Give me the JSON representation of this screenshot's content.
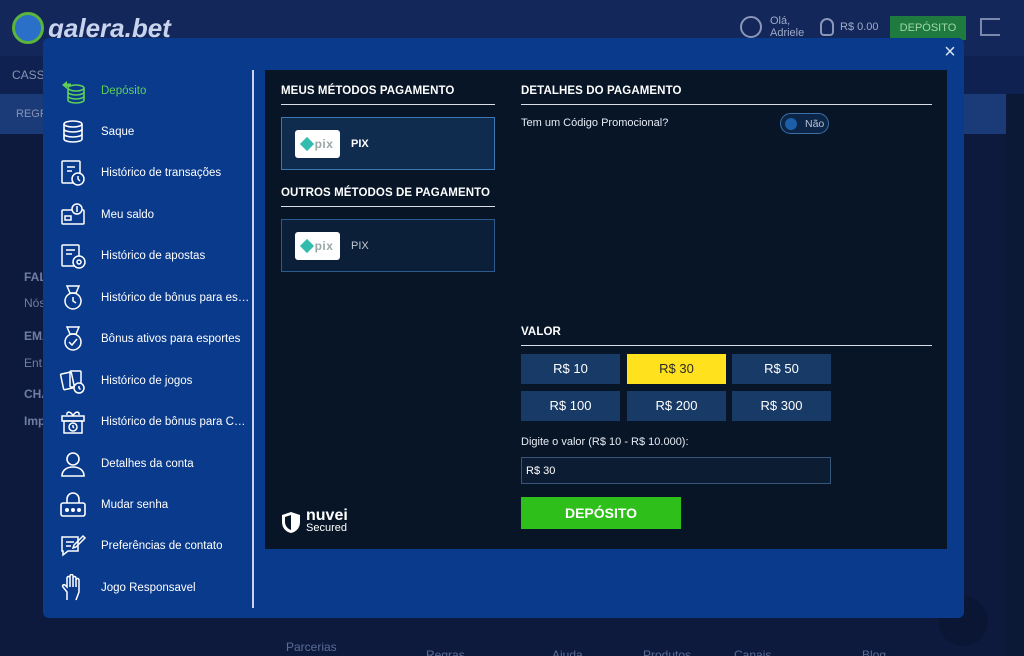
{
  "background": {
    "logo_text": "galera.bet",
    "user_greeting_line1": "Olá,",
    "user_greeting_line2": "Adriele",
    "balance": "R$ 0.00",
    "deposit_label": "DEPÓSITO",
    "nav_fragment": "CASS",
    "subnav_fragment": "REGR",
    "fragments": [
      "FAL",
      "Nós",
      "EMA",
      "Ent",
      "CHA",
      "Imp"
    ],
    "footer_fragments": [
      "Parcerias",
      "Regras",
      "Ajuda",
      "Produtos",
      "Canais",
      "Blog"
    ]
  },
  "modal": {
    "close_icon": "×",
    "menu": [
      {
        "label": "Depósito",
        "icon": "coins-stack-icon",
        "active": true
      },
      {
        "label": "Saque",
        "icon": "withdraw-icon",
        "active": false
      },
      {
        "label": "Histórico de transações",
        "icon": "transaction-history-icon",
        "active": false
      },
      {
        "label": "Meu saldo",
        "icon": "wallet-icon",
        "active": false
      },
      {
        "label": "Histórico de apostas",
        "icon": "bet-history-icon",
        "active": false
      },
      {
        "label": "Histórico de bônus para esportes",
        "icon": "sports-bonus-history-icon",
        "active": false
      },
      {
        "label": "Bônus ativos para esportes",
        "icon": "medal-check-icon",
        "active": false
      },
      {
        "label": "Histórico de jogos",
        "icon": "cards-history-icon",
        "active": false
      },
      {
        "label": "Histórico de bônus para Cassino",
        "icon": "gift-clock-icon",
        "active": false
      },
      {
        "label": "Detalhes da conta",
        "icon": "user-icon",
        "active": false
      },
      {
        "label": "Mudar senha",
        "icon": "lock-icon",
        "active": false
      },
      {
        "label": "Preferências de contato",
        "icon": "contact-form-icon",
        "active": false
      },
      {
        "label": "Jogo Responsavel",
        "icon": "hand-icon",
        "active": false
      }
    ],
    "my_methods_title": "MEUS MÉTODOS PAGAMENTO",
    "other_methods_title": "OUTROS MÉTODOS DE PAGAMENTO",
    "my_method": {
      "label": "PIX",
      "logo_text": "pix"
    },
    "other_method": {
      "label": "PIX",
      "logo_text": "pix"
    },
    "details_title": "DETALHES DO PAGAMENTO",
    "promo_question": "Tem um Código Promocional?",
    "promo_toggle": "Não",
    "value_title": "VALOR",
    "amounts": [
      "R$ 10",
      "R$ 30",
      "R$ 50",
      "R$ 100",
      "R$ 200",
      "R$ 300"
    ],
    "selected_amount": "R$ 30",
    "value_hint": "Digite o valor (R$ 10 - R$ 10.000):",
    "value_input": "R$ 30",
    "deposit_button": "DEPÓSITO",
    "nuvei_name": "nuvei",
    "nuvei_sub": "Secured",
    "colors": {
      "modal_bg": "#0a3a8b",
      "content_bg": "#071527",
      "active_menu": "#5ed05a",
      "selected_amount": "#ffe11e",
      "deposit_green": "#2fbf1b"
    }
  }
}
